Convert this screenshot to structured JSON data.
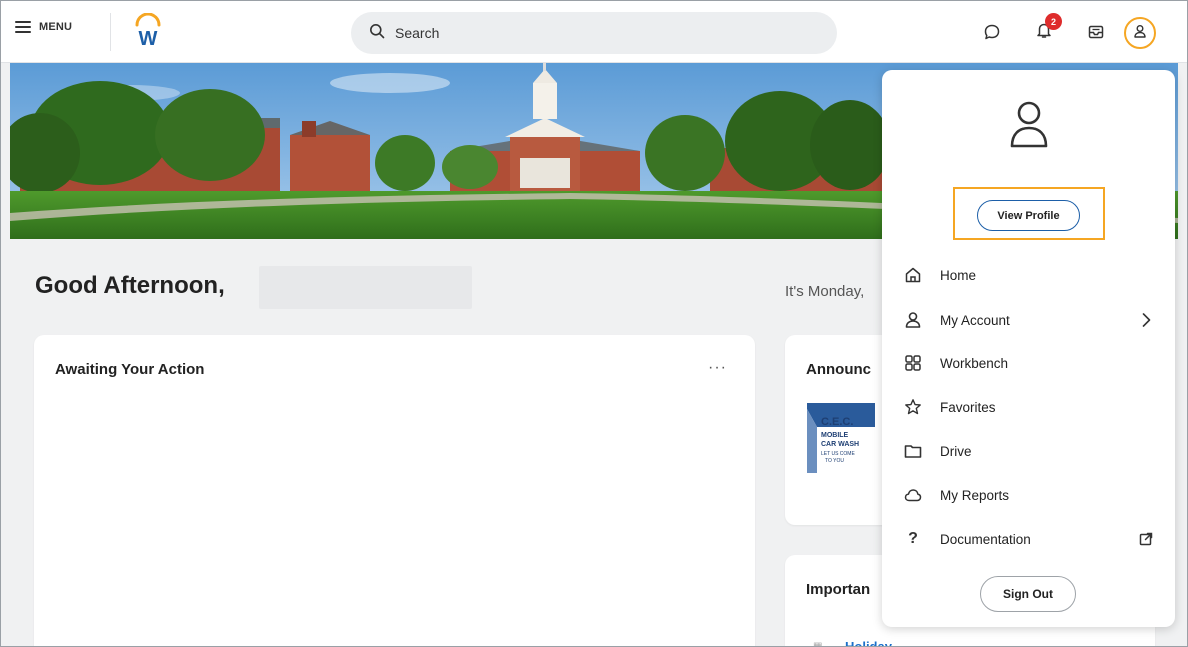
{
  "topbar": {
    "menu_label": "MENU",
    "logo_letter": "W",
    "search_placeholder": "Search",
    "notification_count": "2",
    "icons": [
      "menu-icon",
      "workday-logo",
      "search-icon",
      "chat-icon",
      "bell-icon",
      "inbox-icon",
      "user-icon"
    ],
    "accent_color": "#f5a623",
    "badge_color": "#de2c2c"
  },
  "main": {
    "greeting": "Good Afternoon,",
    "date_text": "It's Monday,",
    "awaiting": {
      "title": "Awaiting Your Action",
      "more_label": "···"
    },
    "announcements": {
      "title": "Announc",
      "logo_text": [
        "C.E.C.",
        "MOBILE",
        "CAR WASH",
        "LET US COME",
        "TO YOU"
      ]
    },
    "important": {
      "title": "Importan",
      "item": "Holiday"
    }
  },
  "profile_menu": {
    "view_profile": "View Profile",
    "items": [
      {
        "label": "Home",
        "icon": "home-icon"
      },
      {
        "label": "My Account",
        "icon": "user-icon",
        "trailing": "chevron-right-icon"
      },
      {
        "label": "Workbench",
        "icon": "workbench-icon"
      },
      {
        "label": "Favorites",
        "icon": "star-icon"
      },
      {
        "label": "Drive",
        "icon": "folder-icon"
      },
      {
        "label": "My Reports",
        "icon": "cloud-icon"
      },
      {
        "label": "Documentation",
        "icon": "question-icon",
        "trailing": "external-link-icon"
      }
    ],
    "sign_out": "Sign Out",
    "highlight_color": "#f5a623",
    "button_border_color": "#1d5fa8"
  }
}
